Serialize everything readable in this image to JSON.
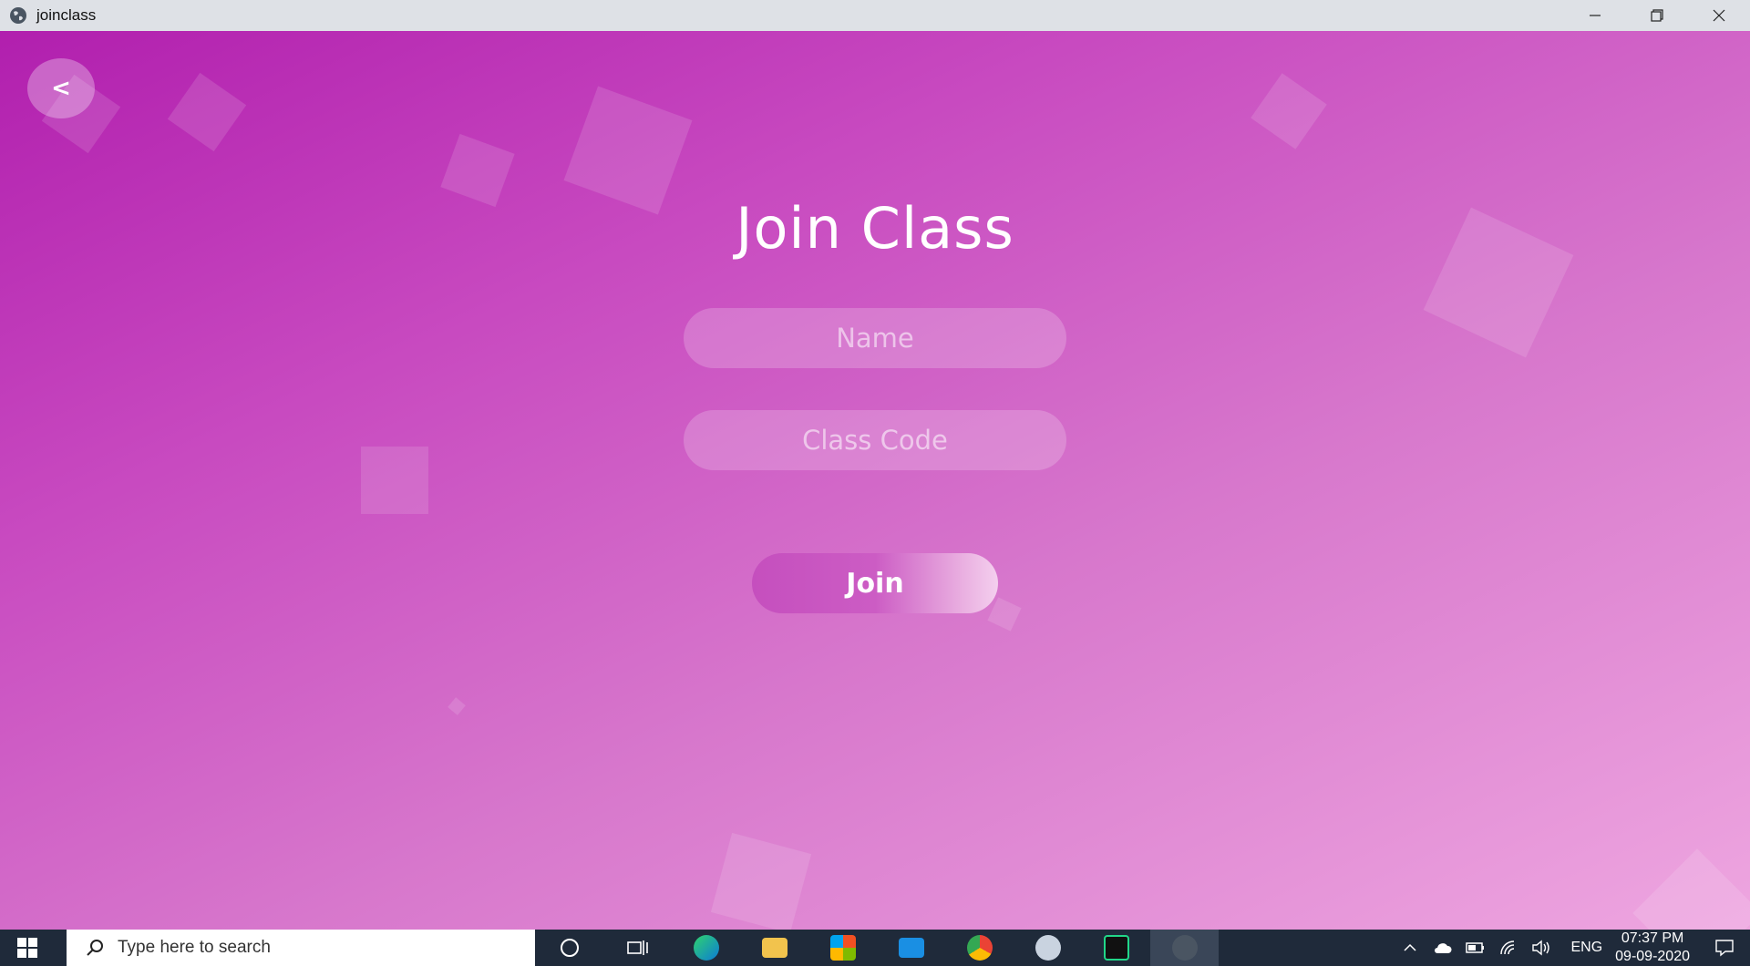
{
  "window": {
    "title": "joinclass"
  },
  "app": {
    "back_label": "<",
    "heading": "Join Class",
    "name_field": {
      "placeholder": "Name",
      "value": ""
    },
    "class_code_field": {
      "placeholder": "Class Code",
      "value": ""
    },
    "join_label": "Join"
  },
  "taskbar": {
    "search_placeholder": "Type here to search",
    "language": "ENG",
    "time": "07:37 PM",
    "date": "09-09-2020",
    "pinned": [
      "cortana-icon",
      "task-view-icon",
      "edge-icon",
      "file-explorer-icon",
      "store-icon",
      "mail-icon",
      "chrome-icon",
      "app-icon",
      "pycharm-icon",
      "joinclass-app-icon"
    ]
  },
  "colors": {
    "gradient_start": "#b11fae",
    "gradient_end": "#eea6e0",
    "taskbar": "#1f2a3a",
    "titlebar": "#dee1e6"
  }
}
